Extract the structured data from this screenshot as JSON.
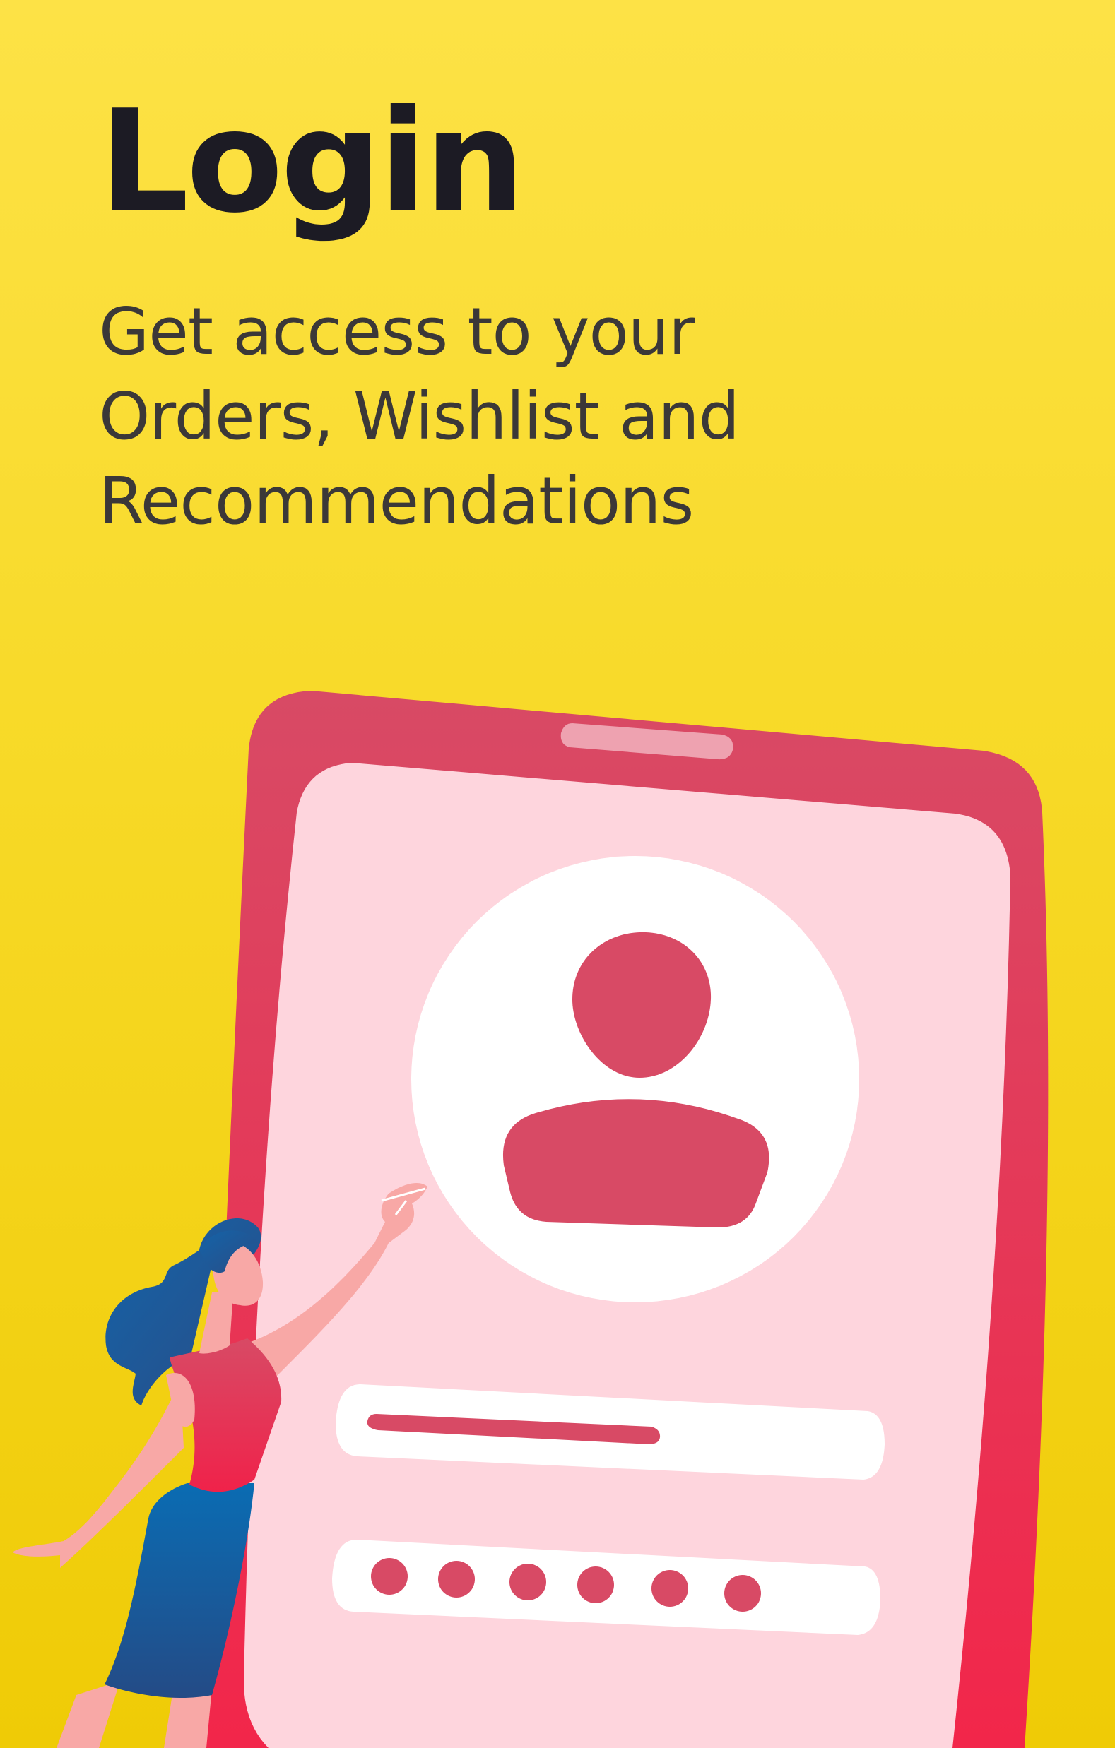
{
  "screen": {
    "title": "Login",
    "subtitle_lines": [
      "Get access to your",
      "Orders, Wishlist and",
      "Recommendations"
    ]
  },
  "illustration": {
    "name": "login-phone-illustration",
    "password_mask_count": 6,
    "colors": {
      "background_top": "#fde246",
      "background_bottom": "#efcb06",
      "phone_frame": "#e0385c",
      "phone_screen": "#fed5dd",
      "accent": "#d84a65",
      "hair": "#1d5fa0",
      "skin": "#f8a8a6",
      "dress_top": "#e5385a",
      "skirt": "#1a5a96"
    },
    "icons": [
      "user-avatar-icon",
      "password-dots-icon"
    ]
  }
}
